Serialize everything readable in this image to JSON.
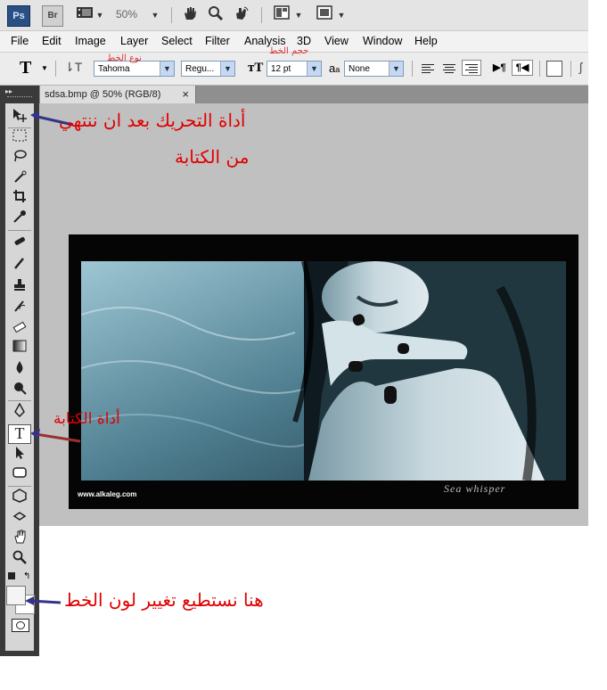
{
  "appbar": {
    "ps_label": "Ps",
    "br_label": "Br",
    "zoom": "50%"
  },
  "menu": [
    "File",
    "Edit",
    "Image",
    "Layer",
    "Select",
    "Filter",
    "Analysis",
    "3D",
    "View",
    "Window",
    "Help"
  ],
  "options": {
    "font_family": "Tahoma",
    "font_style": "Regu...",
    "font_size": "12 pt",
    "antialias_icon_text": "a",
    "antialias_sub": "a",
    "antialias": "None"
  },
  "document": {
    "tab_title": "sdsa.bmp @ 50% (RGB/8)",
    "close_glyph": "×",
    "url_text": "www.alkaleg.com",
    "signature_text": "Sea whisper"
  },
  "annotations": {
    "move_tool": "أداة التحريك بعد ان ننتهي",
    "move_tool_line2": "من الكتابة",
    "font_type": "نوع الخط",
    "font_size": "حجم الخط",
    "type_tool": "أداة الكتابة",
    "color": "هنا نستطيع تغيير لون الخط"
  },
  "colors": {
    "annotation": "#e00000",
    "arrow": "#33338a",
    "app_chrome": "#e4e4e4",
    "toolbox": "#3a3a3a",
    "canvas_bg": "#c0c0c0"
  },
  "icons": [
    "photoshop-logo",
    "bridge-logo",
    "film-icon",
    "hand-icon",
    "zoom-icon",
    "rotate-icon",
    "arrange-icon",
    "screen-mode-icon",
    "type-tool-icon",
    "orientation-icon",
    "font-size-icon",
    "align-left-icon",
    "align-center-icon",
    "align-right-icon",
    "ltr-icon",
    "rtl-icon",
    "color-swatch-icon"
  ]
}
